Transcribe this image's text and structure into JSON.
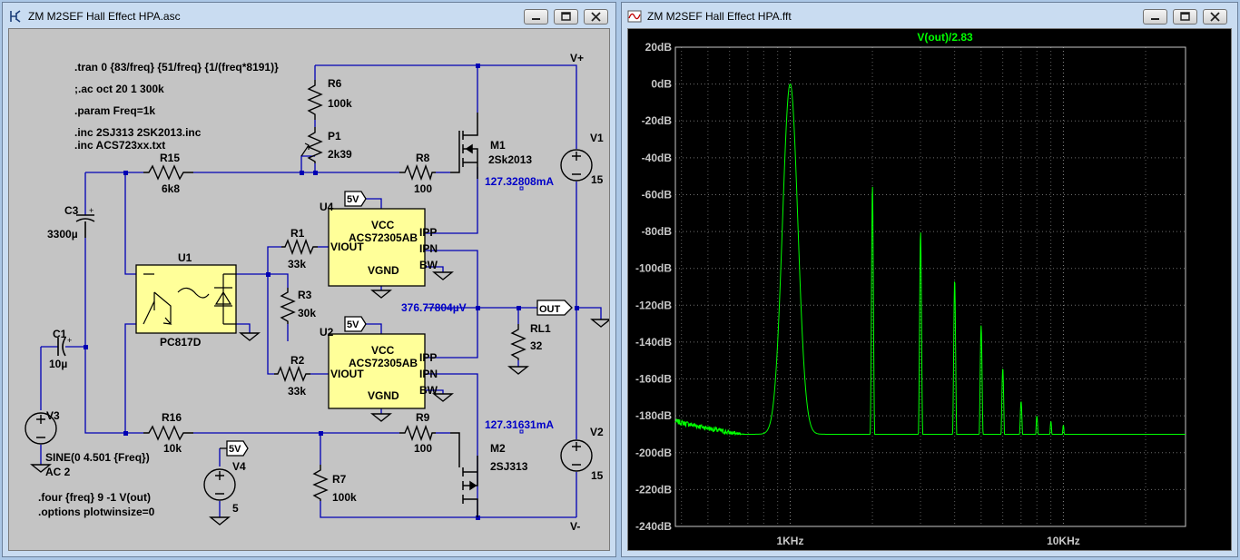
{
  "left_window": {
    "title": "ZM M2SEF Hall Effect HPA.asc",
    "icon": "schematic-icon"
  },
  "right_window": {
    "title": "ZM M2SEF Hall Effect HPA.fft",
    "icon": "waveform-icon"
  },
  "window_controls": {
    "minimize_icon": "minimize-icon",
    "maximize_icon": "maximize-icon",
    "close_icon": "close-icon"
  },
  "schematic": {
    "directives": {
      "tran": ".tran 0 {83/freq} {51/freq} {1/(freq*8191)}",
      "ac": ";.ac oct 20 1 300k",
      "param": ".param Freq=1k",
      "inc1": ".inc 2SJ313 2SK2013.inc",
      "inc2": ".inc ACS723xx.txt",
      "four": ".four {freq} 9 -1 V(out)",
      "options": ".options plotwinsize=0"
    },
    "nets": {
      "vplus": "V+",
      "vminus": "V-",
      "out": "OUT",
      "fivev_a": "5V",
      "fivev_b": "5V",
      "fivev_c": "5V"
    },
    "components": {
      "r6_name": "R6",
      "r6_value": "100k",
      "p1_name": "P1",
      "p1_value": "2k39",
      "r15_name": "R15",
      "r15_value": "6k8",
      "r8_name": "R8",
      "r8_value": "100",
      "m1_name": "M1",
      "m1_model": "2Sk2013",
      "v1_name": "V1",
      "v1_value": "15",
      "c3_name": "C3",
      "c3_value": "3300µ",
      "u4_name": "U4",
      "u2_name": "U2",
      "r1_name": "R1",
      "r1_value": "33k",
      "r3_name": "R3",
      "r3_value": "30k",
      "r2_name": "R2",
      "r2_value": "33k",
      "u1_name": "U1",
      "u1_model": "PC817D",
      "c1_name": "C1",
      "c1_value": "10µ",
      "v3_name": "V3",
      "v3_sine": "SINE(0 4.501 {Freq})",
      "v3_ac": "AC 2",
      "r16_name": "R16",
      "r16_value": "10k",
      "r9_name": "R9",
      "r9_value": "100",
      "m2_name": "M2",
      "m2_model": "2SJ313",
      "v2_name": "V2",
      "v2_value": "15",
      "r7_name": "R7",
      "r7_value": "100k",
      "v4_name": "V4",
      "v4_value": "5",
      "rl1_name": "RL1",
      "rl1_value": "32"
    },
    "ic": {
      "model": "ACS72305AB",
      "vcc": "VCC",
      "viout": "VIOUT",
      "vgnd": "VGND",
      "ipp": "IPP",
      "ipn": "IPN",
      "bw": "BW"
    },
    "probes": {
      "m1_current": "127.32808mA",
      "m2_current": "127.31631mA",
      "out_voltage": "376.77804µV"
    }
  },
  "chart_data": {
    "type": "line",
    "title": "V(out)/2.83",
    "xscale": "log",
    "xlim": [
      380,
      28000
    ],
    "ylim": [
      -240,
      20
    ],
    "yticks": [
      "20dB",
      "0dB",
      "-20dB",
      "-40dB",
      "-60dB",
      "-80dB",
      "-100dB",
      "-120dB",
      "-140dB",
      "-160dB",
      "-180dB",
      "-200dB",
      "-220dB",
      "-240dB"
    ],
    "xtick_labels": [
      "1KHz",
      "10KHz"
    ],
    "grid": true,
    "series_color": "#00ff00",
    "harmonics": [
      {
        "f": 1000,
        "db": 0
      },
      {
        "f": 2000,
        "db": -55
      },
      {
        "f": 3000,
        "db": -80
      },
      {
        "f": 4000,
        "db": -106
      },
      {
        "f": 5000,
        "db": -131
      },
      {
        "f": 6000,
        "db": -154
      },
      {
        "f": 7000,
        "db": -172
      },
      {
        "f": 8000,
        "db": -180
      },
      {
        "f": 9000,
        "db": -183
      },
      {
        "f": 10000,
        "db": -185
      }
    ],
    "noise_floor_db": -200,
    "low_end": {
      "start_f": 380,
      "start_db": -183,
      "dip_f": 800,
      "dip_db": -193
    }
  }
}
